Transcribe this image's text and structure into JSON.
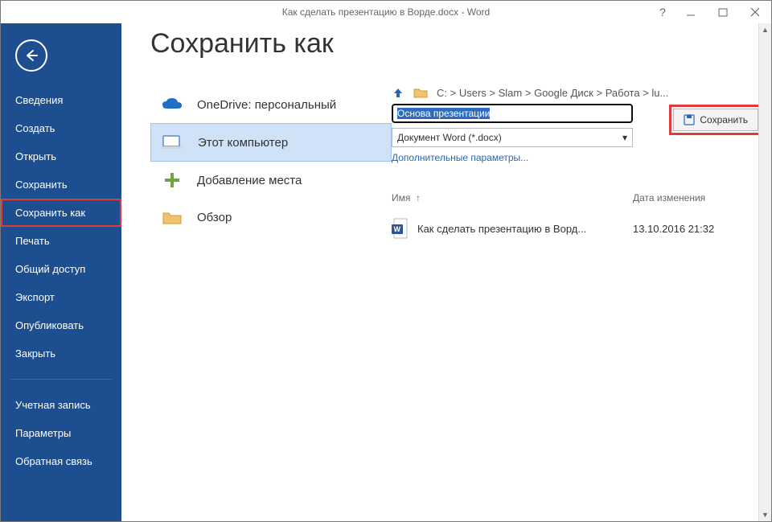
{
  "window": {
    "title": "Как сделать презентацию в Ворде.docx - Word"
  },
  "sidebar": {
    "items": [
      {
        "label": "Сведения"
      },
      {
        "label": "Создать"
      },
      {
        "label": "Открыть"
      },
      {
        "label": "Сохранить"
      },
      {
        "label": "Сохранить как",
        "selected": true
      },
      {
        "label": "Печать"
      },
      {
        "label": "Общий доступ"
      },
      {
        "label": "Экспорт"
      },
      {
        "label": "Опубликовать"
      },
      {
        "label": "Закрыть"
      }
    ],
    "footer": [
      {
        "label": "Учетная запись"
      },
      {
        "label": "Параметры"
      },
      {
        "label": "Обратная связь"
      }
    ]
  },
  "page": {
    "title": "Сохранить как"
  },
  "locations": [
    {
      "id": "onedrive",
      "title": "OneDrive: персональный",
      "sub": ""
    },
    {
      "id": "thispc",
      "title": "Этот компьютер",
      "selected": true
    },
    {
      "id": "addplace",
      "title": "Добавление места"
    },
    {
      "id": "browse",
      "title": "Обзор"
    }
  ],
  "breadcrumb": {
    "parts": [
      "C:",
      "Users",
      "Slam",
      "Google Диск",
      "Работа",
      "lu..."
    ]
  },
  "filename": {
    "value": "Основа презентации"
  },
  "filetype": {
    "selected": "Документ Word (*.docx)"
  },
  "more_link": "Дополнительные параметры...",
  "save_button": "Сохранить",
  "columns": {
    "name": "Имя",
    "date": "Дата изменения"
  },
  "files": [
    {
      "name": "Как сделать презентацию в Ворд...",
      "date": "13.10.2016 21:32"
    }
  ]
}
